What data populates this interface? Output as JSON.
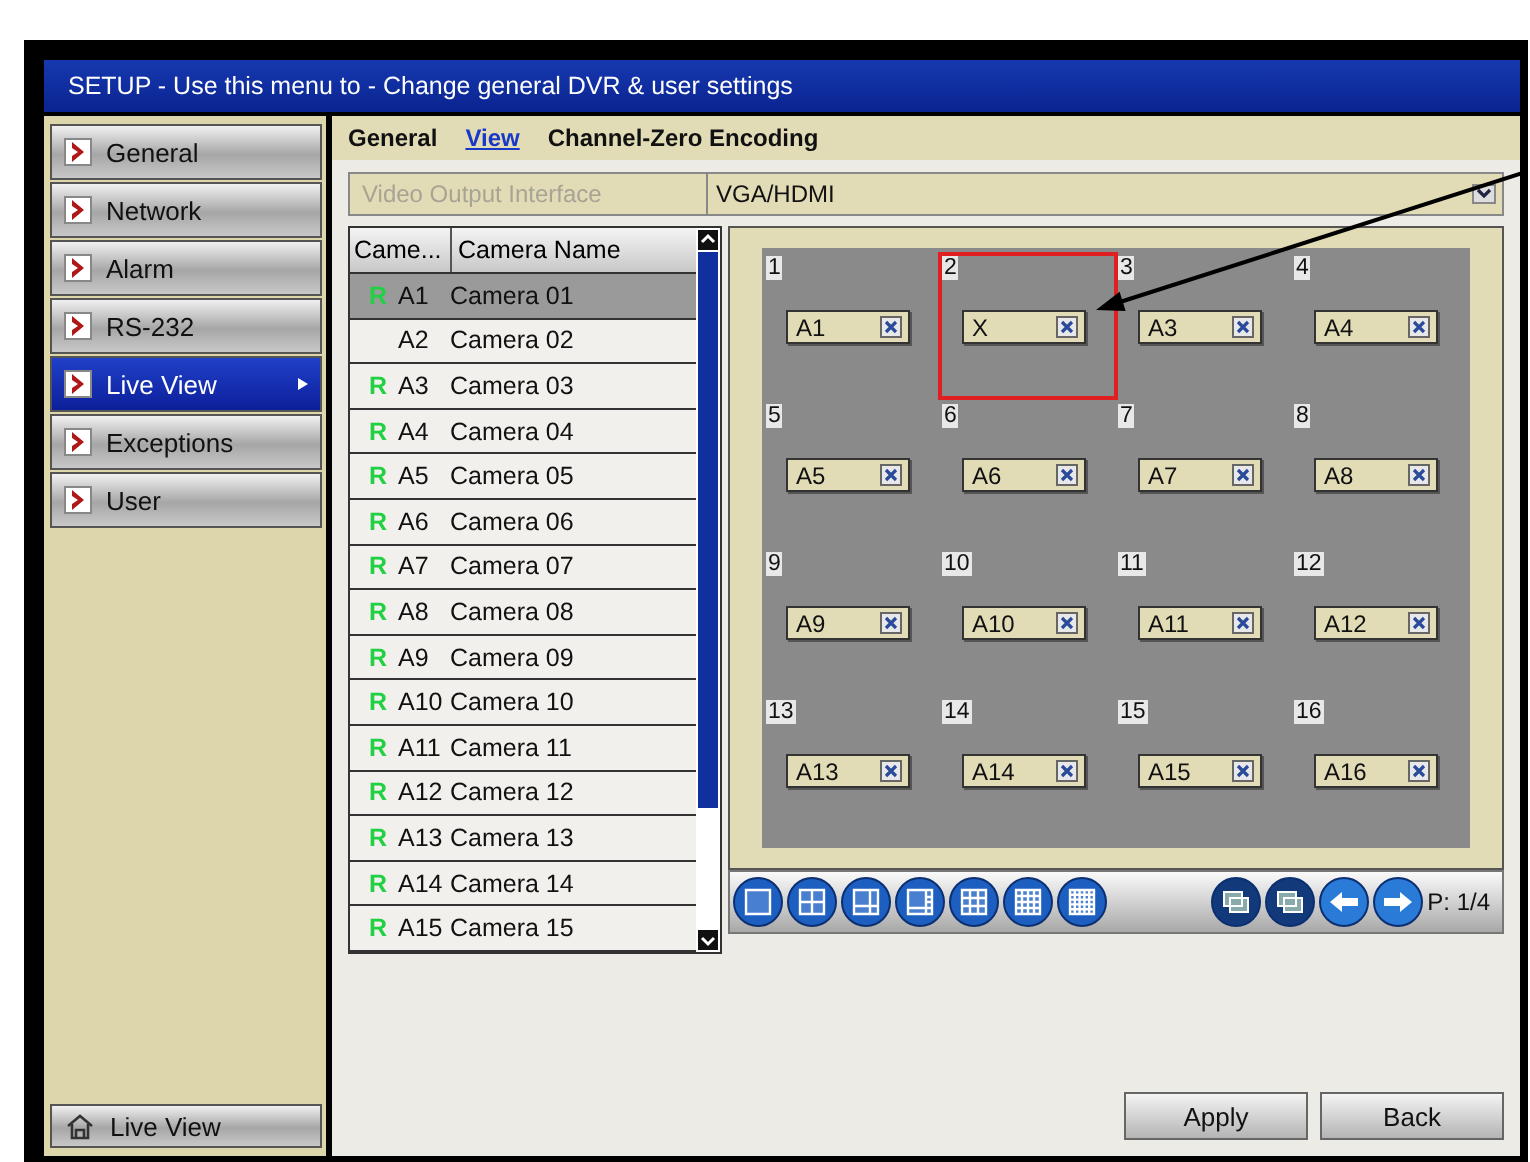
{
  "window": {
    "title": "SETUP - Use this menu to - Change general DVR & user settings"
  },
  "sidebar": {
    "items": [
      {
        "label": "General",
        "selected": false
      },
      {
        "label": "Network",
        "selected": false
      },
      {
        "label": "Alarm",
        "selected": false
      },
      {
        "label": "RS-232",
        "selected": false
      },
      {
        "label": "Live View",
        "selected": true
      },
      {
        "label": "Exceptions",
        "selected": false
      },
      {
        "label": "User",
        "selected": false
      }
    ],
    "bottom_button": "Live View"
  },
  "tabs": [
    {
      "label": "General",
      "selected": false
    },
    {
      "label": "View",
      "selected": true
    },
    {
      "label": "Channel-Zero Encoding",
      "selected": false
    }
  ],
  "video_output": {
    "label": "Video Output Interface",
    "value": "VGA/HDMI"
  },
  "camera_list": {
    "columns": [
      "Came...",
      "Camera Name"
    ],
    "rows": [
      {
        "record": "R",
        "camera": "A1",
        "name": "Camera 01",
        "selected": true
      },
      {
        "record": "",
        "camera": "A2",
        "name": "Camera 02",
        "selected": false
      },
      {
        "record": "R",
        "camera": "A3",
        "name": "Camera 03",
        "selected": false
      },
      {
        "record": "R",
        "camera": "A4",
        "name": "Camera 04",
        "selected": false
      },
      {
        "record": "R",
        "camera": "A5",
        "name": "Camera 05",
        "selected": false
      },
      {
        "record": "R",
        "camera": "A6",
        "name": "Camera 06",
        "selected": false
      },
      {
        "record": "R",
        "camera": "A7",
        "name": "Camera 07",
        "selected": false
      },
      {
        "record": "R",
        "camera": "A8",
        "name": "Camera 08",
        "selected": false
      },
      {
        "record": "R",
        "camera": "A9",
        "name": "Camera 09",
        "selected": false
      },
      {
        "record": "R",
        "camera": "A10",
        "name": "Camera 10",
        "selected": false
      },
      {
        "record": "R",
        "camera": "A11",
        "name": "Camera 11",
        "selected": false
      },
      {
        "record": "R",
        "camera": "A12",
        "name": "Camera 12",
        "selected": false
      },
      {
        "record": "R",
        "camera": "A13",
        "name": "Camera 13",
        "selected": false
      },
      {
        "record": "R",
        "camera": "A14",
        "name": "Camera 14",
        "selected": false
      },
      {
        "record": "R",
        "camera": "A15",
        "name": "Camera 15",
        "selected": false
      }
    ]
  },
  "layout_grid": {
    "cells": [
      {
        "number": "1",
        "channel": "A1",
        "selected": false
      },
      {
        "number": "2",
        "channel": "X",
        "selected": true
      },
      {
        "number": "3",
        "channel": "A3",
        "selected": false
      },
      {
        "number": "4",
        "channel": "A4",
        "selected": false
      },
      {
        "number": "5",
        "channel": "A5",
        "selected": false
      },
      {
        "number": "6",
        "channel": "A6",
        "selected": false
      },
      {
        "number": "7",
        "channel": "A7",
        "selected": false
      },
      {
        "number": "8",
        "channel": "A8",
        "selected": false
      },
      {
        "number": "9",
        "channel": "A9",
        "selected": false
      },
      {
        "number": "10",
        "channel": "A10",
        "selected": false
      },
      {
        "number": "11",
        "channel": "A11",
        "selected": false
      },
      {
        "number": "12",
        "channel": "A12",
        "selected": false
      },
      {
        "number": "13",
        "channel": "A13",
        "selected": false
      },
      {
        "number": "14",
        "channel": "A14",
        "selected": false
      },
      {
        "number": "15",
        "channel": "A15",
        "selected": false
      },
      {
        "number": "16",
        "channel": "A16",
        "selected": false
      }
    ]
  },
  "toolbar": {
    "layouts": [
      {
        "kind": "single"
      },
      {
        "kind": "quad"
      },
      {
        "kind": "six"
      },
      {
        "kind": "eight"
      },
      {
        "kind": "nine"
      },
      {
        "kind": "sixteen"
      },
      {
        "kind": "twentyfive"
      }
    ],
    "page": "P: 1/4"
  },
  "buttons": [
    "Apply",
    "Back"
  ]
}
